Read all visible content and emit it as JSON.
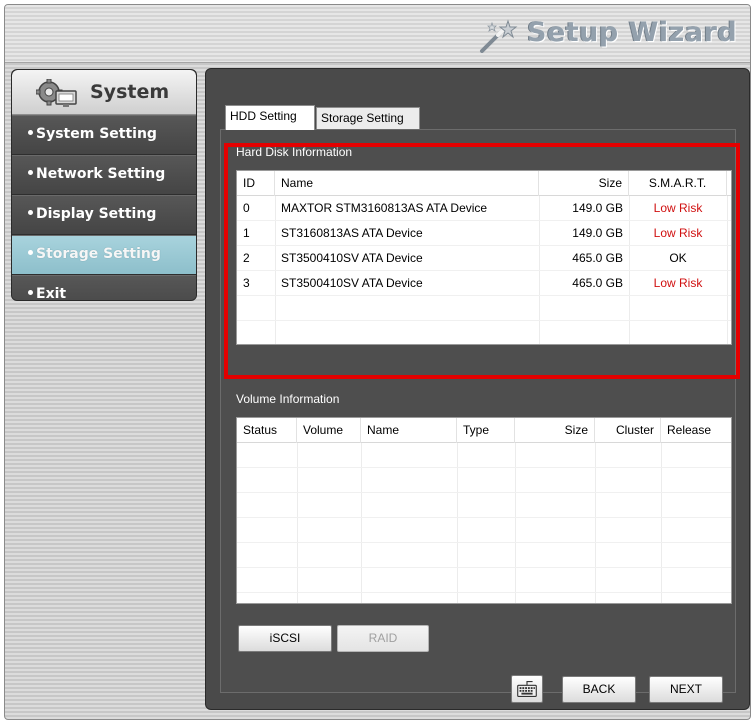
{
  "header": {
    "title": "Setup Wizard",
    "icon": "magic-wand-icon"
  },
  "sidebar": {
    "title": "System",
    "icon": "gear-monitor-icon",
    "items": [
      {
        "label": "System Setting"
      },
      {
        "label": "Network Setting"
      },
      {
        "label": "Display Setting"
      },
      {
        "label": "Storage Setting",
        "active": true
      },
      {
        "label": "Exit"
      }
    ]
  },
  "tabs": [
    {
      "label": "HDD Setting",
      "active": true
    },
    {
      "label": "Storage Setting"
    }
  ],
  "hard_disk": {
    "title": "Hard Disk Information",
    "columns": [
      "ID",
      "Name",
      "Size",
      "S.M.A.R.T."
    ],
    "rows": [
      {
        "id": "0",
        "name": "MAXTOR STM3160813AS ATA Device",
        "size": "149.0 GB",
        "smart": "Low Risk"
      },
      {
        "id": "1",
        "name": "ST3160813AS ATA Device",
        "size": "149.0 GB",
        "smart": "Low Risk"
      },
      {
        "id": "2",
        "name": "ST3500410SV ATA Device",
        "size": "465.0 GB",
        "smart": "OK"
      },
      {
        "id": "3",
        "name": "ST3500410SV ATA Device",
        "size": "465.0 GB",
        "smart": "Low Risk"
      }
    ]
  },
  "volume": {
    "title": "Volume Information",
    "columns": [
      "Status",
      "Volume",
      "Name",
      "Type",
      "Size",
      "Cluster",
      "Release"
    ]
  },
  "buttons": {
    "iscsi": "iSCSI",
    "raid": "RAID",
    "back": "BACK",
    "next": "NEXT",
    "keyboard_icon": "keyboard-icon"
  },
  "colors": {
    "risk": "#d01010",
    "highlight": "#e40000",
    "active_item": "#9ccbd6"
  }
}
